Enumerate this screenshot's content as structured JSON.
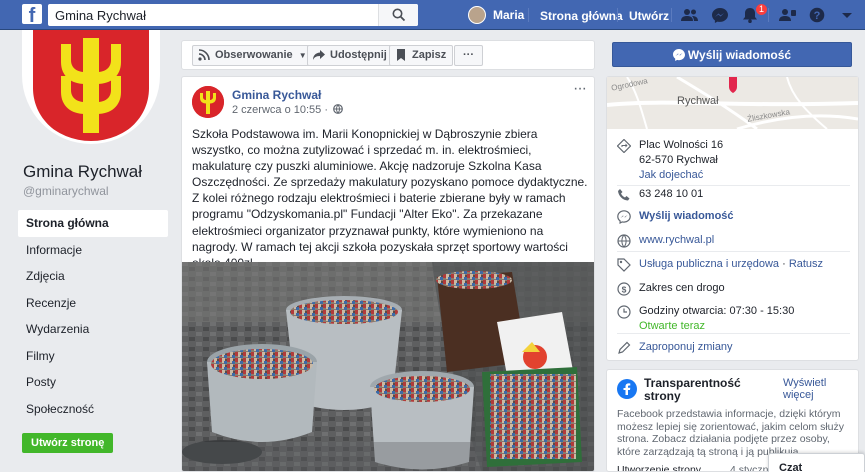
{
  "topbar": {
    "search_value": "Gmina Rychwał",
    "user_name": "Maria",
    "home_label": "Strona główna",
    "create_label": "Utwórz",
    "notification_count": "1"
  },
  "sidebar": {
    "page_name": "Gmina Rychwał",
    "handle": "@gminarychwal",
    "items": [
      {
        "label": "Strona główna",
        "active": true
      },
      {
        "label": "Informacje"
      },
      {
        "label": "Zdjęcia"
      },
      {
        "label": "Recenzje"
      },
      {
        "label": "Wydarzenia"
      },
      {
        "label": "Filmy"
      },
      {
        "label": "Posty"
      },
      {
        "label": "Społeczność"
      }
    ],
    "create_page_label": "Utwórz stronę"
  },
  "actions": {
    "follow_label": "Obserwowanie",
    "share_label": "Udostępnij",
    "save_label": "Zapisz",
    "more_label": "···",
    "send_message_label": "Wyślij wiadomość"
  },
  "post": {
    "author": "Gmina Rychwał",
    "date": "2 czerwca o 10:55 ·",
    "more": "···",
    "text": "Szkoła Podstawowa im. Marii Konopnickiej w Dąbroszynie zbiera wszystko, co można zutylizować i sprzedać m. in. elektrośmieci, makulaturę czy puszki aluminiowe. Akcję nadzoruje Szkolna Kasa Oszczędności. Ze sprzedaży makulatury pozyskano pomoce dydaktyczne. Z kolei różnego rodzaju elektrośmieci i baterie zbierane były w ramach programu \"Odzyskomania.pl\" Fundacji \"Alter Eko\". Za przekazane elektrośmieci organizator przyznawał punkty, które wymieniono na nagrody. W ramach tej akcji szkoła pozyskała sprzęt sportowy wartości około 400zł."
  },
  "info": {
    "map_label_town": "Rychwał",
    "map_label_street1": "Ogrodowa",
    "map_label_street2": "Źliszkowska",
    "address_line1": "Plac Wolności 16",
    "address_line2": "62-570 Rychwał",
    "directions": "Jak dojechać",
    "phone": "63 248 10 01",
    "send_message": "Wyślij wiadomość",
    "website": "www.rychwal.pl",
    "category": "Usługa publiczna i urzędowa",
    "category_sep": " · ",
    "category2": "Ratusz",
    "price_range": "Zakres cen drogo",
    "hours": "Godziny otwarcia: 07:30 - 15:30",
    "open_now": "Otwarte teraz",
    "suggest_edits": "Zaproponuj zmiany"
  },
  "transparency": {
    "title": "Transparentność strony",
    "see_more": "Wyświetl więcej",
    "text": "Facebook przedstawia informacje, dzięki którym możesz lepiej się zorientować, jakim celom służy strona. Zobacz działania podjęte przez osoby, które zarządzają tą stroną i ją publikują.",
    "footer_left": "Utworzenie strony",
    "footer_right": "4 stycznia"
  },
  "chat": {
    "label": "Czat"
  },
  "colors": {
    "brand": "#4267b2",
    "link": "#385898",
    "green": "#42b72a"
  }
}
